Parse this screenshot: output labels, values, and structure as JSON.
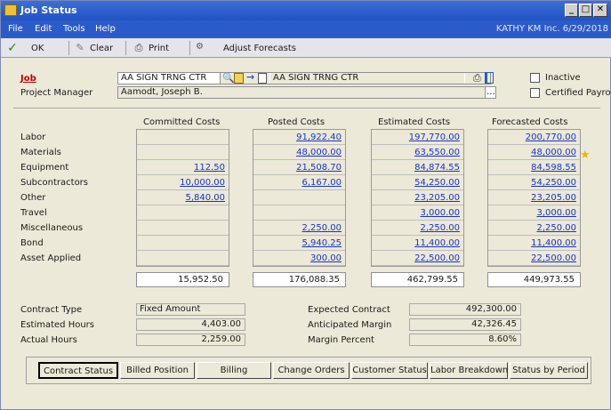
{
  "window": {
    "title": "Job Status"
  },
  "menu": {
    "items": [
      "File",
      "Edit",
      "Tools",
      "Help"
    ],
    "company": "KATHY  KM Inc.  6/29/2018"
  },
  "toolbar": {
    "ok": "OK",
    "clear": "Clear",
    "print": "Print",
    "adjust": "Adjust Forecasts"
  },
  "header": {
    "job_label": "Job",
    "job_value": "AA SIGN TRNG CTR",
    "job_desc": "AA SIGN TRNG CTR",
    "pm_label": "Project Manager",
    "pm_value": "Aamodt, Joseph B.",
    "inactive_label": "Inactive",
    "certified_label": "Certified Payroll"
  },
  "costs": {
    "columns": [
      "Committed Costs",
      "Posted Costs",
      "Estimated Costs",
      "Forecasted Costs"
    ],
    "rows": [
      {
        "label": "Labor",
        "committed": "",
        "posted": "91,922.40",
        "estimated": "197,770.00",
        "forecasted": "200,770.00"
      },
      {
        "label": "Materials",
        "committed": "",
        "posted": "48,000.00",
        "estimated": "63,550.00",
        "forecasted": "48,000.00"
      },
      {
        "label": "Equipment",
        "committed": "112.50",
        "posted": "21,508.70",
        "estimated": "84,874.55",
        "forecasted": "84,598.55"
      },
      {
        "label": "Subcontractors",
        "committed": "10,000.00",
        "posted": "6,167.00",
        "estimated": "54,250.00",
        "forecasted": "54,250.00"
      },
      {
        "label": "Other",
        "committed": "5,840.00",
        "posted": "",
        "estimated": "23,205.00",
        "forecasted": "23,205.00"
      },
      {
        "label": "Travel",
        "committed": "",
        "posted": "",
        "estimated": "3,000.00",
        "forecasted": "3,000.00"
      },
      {
        "label": "Miscellaneous",
        "committed": "",
        "posted": "2,250.00",
        "estimated": "2,250.00",
        "forecasted": "2,250.00"
      },
      {
        "label": "Bond",
        "committed": "",
        "posted": "5,940.25",
        "estimated": "11,400.00",
        "forecasted": "11,400.00"
      },
      {
        "label": "Asset Applied",
        "committed": "",
        "posted": "300.00",
        "estimated": "22,500.00",
        "forecasted": "22,500.00"
      }
    ],
    "totals": {
      "committed": "15,952.50",
      "posted": "176,088.35",
      "estimated": "462,799.55",
      "forecasted": "449,973.55"
    }
  },
  "contract": {
    "type_label": "Contract Type",
    "type_value": "Fixed Amount",
    "est_hours_label": "Estimated Hours",
    "est_hours_value": "4,403.00",
    "act_hours_label": "Actual Hours",
    "act_hours_value": "2,259.00",
    "expected_label": "Expected Contract",
    "expected_value": "492,300.00",
    "margin_label": "Anticipated Margin",
    "margin_value": "42,326.45",
    "percent_label": "Margin Percent",
    "percent_value": "8.60%"
  },
  "buttons": [
    "Contract Status",
    "Billed Position",
    "Billing",
    "Change Orders",
    "Customer Status",
    "Labor Breakdown",
    "Status by Period"
  ],
  "colors": {
    "title_bar": "#2152c4",
    "link": "#1a33c8",
    "job_label": "#c00000",
    "star": "#e8b800"
  }
}
